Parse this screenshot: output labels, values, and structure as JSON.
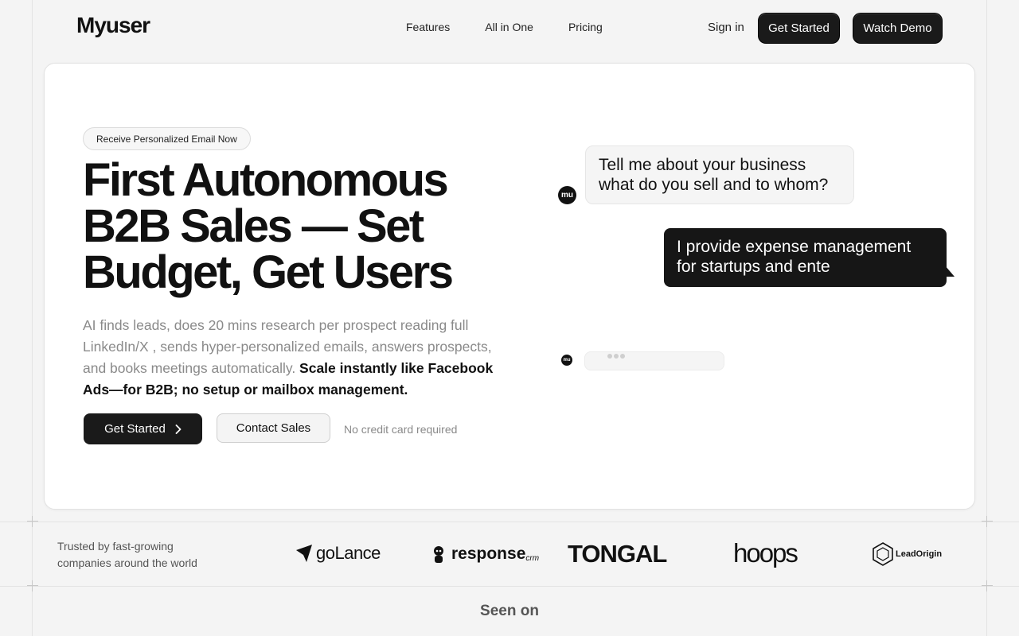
{
  "header": {
    "logo": "Myuser",
    "nav": [
      "Features",
      "All in One",
      "Pricing"
    ],
    "sign_in": "Sign in",
    "get_started": "Get Started",
    "watch_demo": "Watch Demo"
  },
  "hero": {
    "badge": "Receive Personalized Email Now",
    "headline_lines": [
      "First Autonomous",
      "B2B Sales — Set",
      "Budget, Get Users"
    ],
    "subtext_muted": "AI finds leads, does 20 mins research per prospect reading full LinkedIn/X , sends hyper-personalized emails, answers prospects, and books meetings automatically. ",
    "subtext_bold": "Scale instantly like Facebook Ads—for B2B; no setup or mailbox management.",
    "cta_primary": "Get Started",
    "cta_secondary": "Contact Sales",
    "note": "No credit card required"
  },
  "chat": {
    "avatar_label": "mu",
    "bot_message": "Tell me about your business what do you sell and to whom?",
    "user_message": "I provide expense management for startups and ente"
  },
  "trusted": {
    "text_line1": "Trusted by fast-growing",
    "text_line2": "companies around the world",
    "logos": [
      "goLance",
      "response",
      "crm",
      "TONGAL",
      "hoops",
      "LeadOrigin"
    ]
  },
  "seen_on": "Seen on",
  "colors": {
    "dark": "#1a1a1a",
    "background": "#f4f4f4",
    "muted": "#8a8a8a"
  }
}
